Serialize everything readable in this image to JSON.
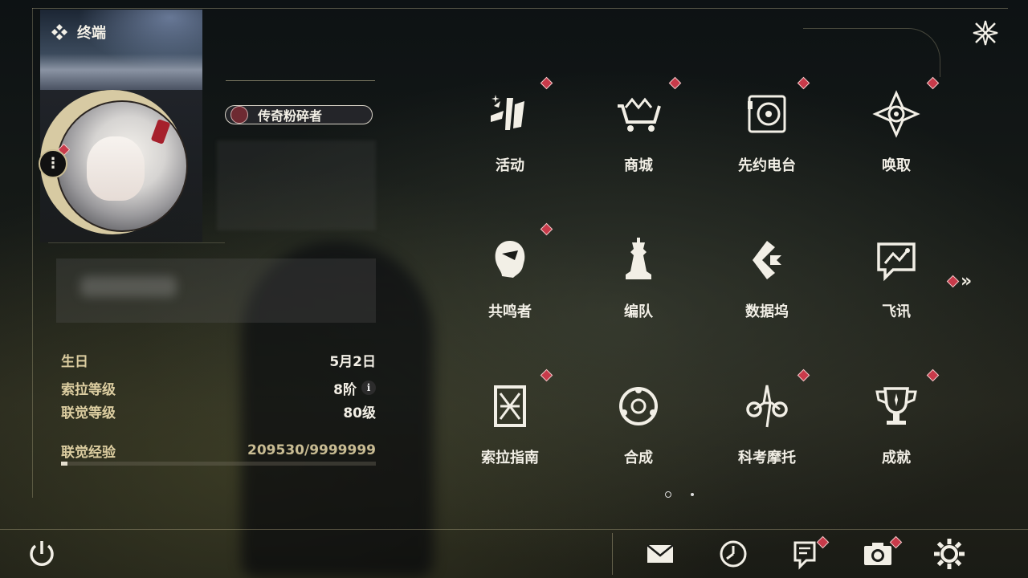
{
  "header": {
    "title": "终端"
  },
  "profile": {
    "title_badge": "传奇粉碎者",
    "stats": [
      {
        "label": "生日",
        "value": "5月2日"
      },
      {
        "label": "索拉等级",
        "value": "8阶"
      },
      {
        "label": "联觉等级",
        "value": "80级"
      },
      {
        "label": "联觉经验",
        "value": "209530/9999999"
      }
    ],
    "info_glyph": "i",
    "more_glyph": "⋮",
    "exp_progress_fraction": 0.021
  },
  "menu": {
    "items": [
      {
        "label": "活动",
        "icon": "activity-icon",
        "has_dot": true
      },
      {
        "label": "商城",
        "icon": "shop-cart-icon",
        "has_dot": true
      },
      {
        "label": "先约电台",
        "icon": "radio-icon",
        "has_dot": true
      },
      {
        "label": "唤取",
        "icon": "compass-star-icon",
        "has_dot": true
      },
      {
        "label": "共鸣者",
        "icon": "resonator-head-icon",
        "has_dot": true
      },
      {
        "label": "编队",
        "icon": "chess-team-icon",
        "has_dot": false
      },
      {
        "label": "数据坞",
        "icon": "data-dock-icon",
        "has_dot": false
      },
      {
        "label": "飞讯",
        "icon": "chat-message-icon",
        "has_dot": false
      },
      {
        "label": "索拉指南",
        "icon": "guide-book-icon",
        "has_dot": true
      },
      {
        "label": "合成",
        "icon": "synthesis-icon",
        "has_dot": false
      },
      {
        "label": "科考摩托",
        "icon": "motorbike-icon",
        "has_dot": true
      },
      {
        "label": "成就",
        "icon": "trophy-icon",
        "has_dot": true
      }
    ],
    "next_page_glyph": "»",
    "pagination": {
      "current": 1,
      "total": 2
    }
  },
  "bottom_bar": {
    "buttons": [
      {
        "icon": "power-icon"
      },
      {
        "icon": "mail-icon"
      },
      {
        "icon": "clock-icon"
      },
      {
        "icon": "notes-icon"
      },
      {
        "icon": "camera-icon"
      },
      {
        "icon": "gear-icon"
      }
    ]
  },
  "colors": {
    "accent_gold": "#dccda0",
    "alert_red": "#c83a4a",
    "text_light": "#f2efe6"
  }
}
